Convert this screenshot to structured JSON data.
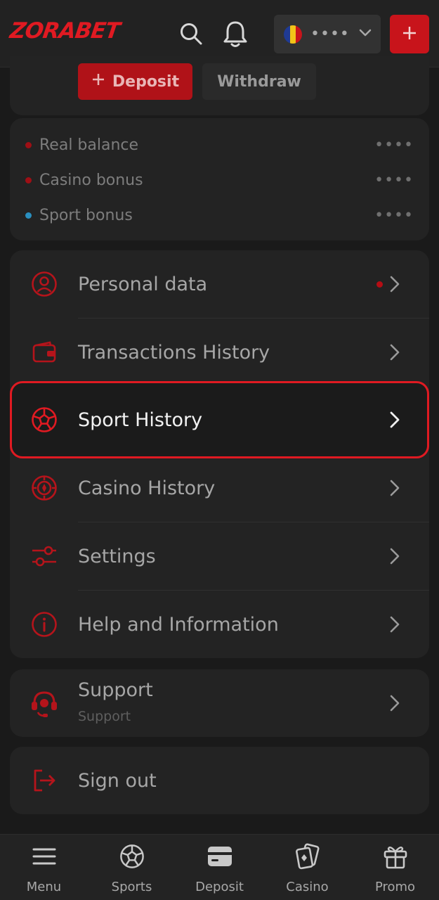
{
  "header": {
    "logo": "ZORABET",
    "country_masked": "••••",
    "icons": [
      "search-icon",
      "bell-icon",
      "chevron-down-icon",
      "plus-icon"
    ]
  },
  "wallet": {
    "deposit_label": "Deposit",
    "withdraw_label": "Withdraw",
    "balances": [
      {
        "label": "Real balance",
        "value": "••••",
        "dot_color": "#9e0f15"
      },
      {
        "label": "Casino bonus",
        "value": "••••",
        "dot_color": "#9e0f15"
      },
      {
        "label": "Sport bonus",
        "value": "••••",
        "dot_color": "#2a8fbf"
      }
    ]
  },
  "menu": {
    "items": [
      {
        "label": "Personal data",
        "icon": "user-circle-icon"
      },
      {
        "label": "Transactions History",
        "icon": "wallet-icon"
      },
      {
        "label": "Sport History",
        "icon": "soccer-ball-icon"
      },
      {
        "label": "Casino History",
        "icon": "casino-chip-icon"
      },
      {
        "label": "Settings",
        "icon": "sliders-icon"
      },
      {
        "label": "Help and Information",
        "icon": "info-icon"
      }
    ]
  },
  "support": {
    "label": "Support",
    "sublabel": "Support",
    "icon": "headset-icon"
  },
  "signout": {
    "label": "Sign out",
    "icon": "logout-icon"
  },
  "bottom_nav": [
    {
      "label": "Menu",
      "icon": "hamburger-icon"
    },
    {
      "label": "Sports",
      "icon": "soccer-ball-icon"
    },
    {
      "label": "Deposit",
      "icon": "card-icon"
    },
    {
      "label": "Casino",
      "icon": "cards-icon"
    },
    {
      "label": "Promo",
      "icon": "gift-icon"
    }
  ],
  "colors": {
    "accent": "#e01a22",
    "background": "#1a1a1a",
    "card": "#232323"
  }
}
